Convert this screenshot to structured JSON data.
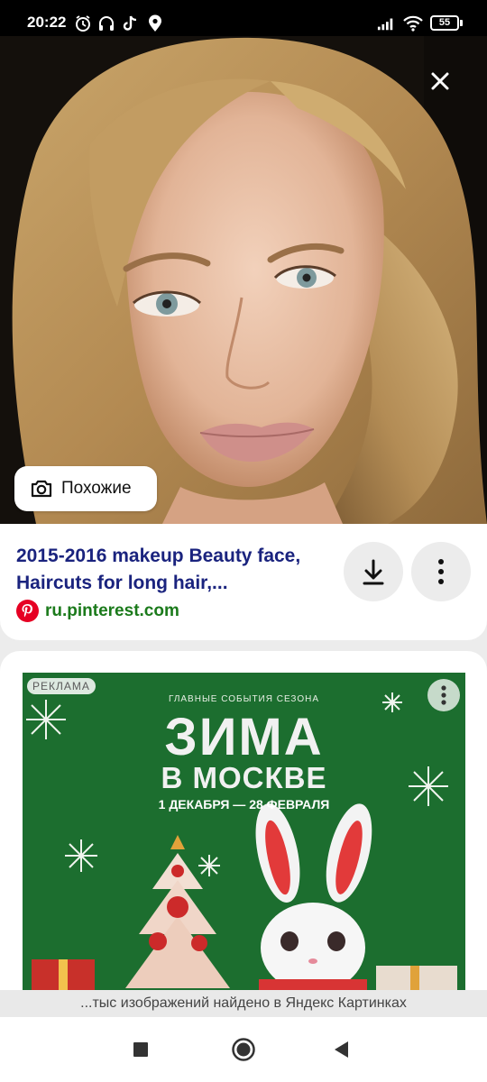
{
  "status_bar": {
    "time": "20:22",
    "battery": "55",
    "icons": [
      "alarm-icon",
      "headset-icon",
      "tiktok-icon",
      "location-icon",
      "signal-icon",
      "wifi-icon",
      "battery-icon"
    ]
  },
  "viewer": {
    "close_icon": "close-icon",
    "similar_button_label": "Похожие",
    "similar_icon": "camera-lens-icon"
  },
  "result": {
    "title": "2015-2016 makeup Beauty face, Haircuts for long hair,...",
    "source_url": "ru.pinterest.com",
    "source_icon": "pinterest-icon",
    "download_icon": "download-icon",
    "more_icon": "more-vertical-icon"
  },
  "ad": {
    "label": "РЕКЛАМА",
    "subtitle": "ГЛАВНЫЕ СОБЫТИЯ СЕЗОНА",
    "title_line1": "ЗИМА",
    "title_line2": "В МОСКВЕ",
    "dates": "1 ДЕКАБРЯ — 28 ФЕВРАЛЯ",
    "more_icon": "more-vertical-icon"
  },
  "footer": {
    "found_text": "...тыс изображений найдено в Яндекс Картинках"
  },
  "nav": {
    "recents_icon": "square-icon",
    "home_icon": "circle-icon",
    "back_icon": "triangle-back-icon"
  },
  "colors": {
    "title_blue": "#1a237e",
    "source_green": "#1b7a1b",
    "pinterest_red": "#e60023",
    "ad_green": "#1c6e2f"
  }
}
